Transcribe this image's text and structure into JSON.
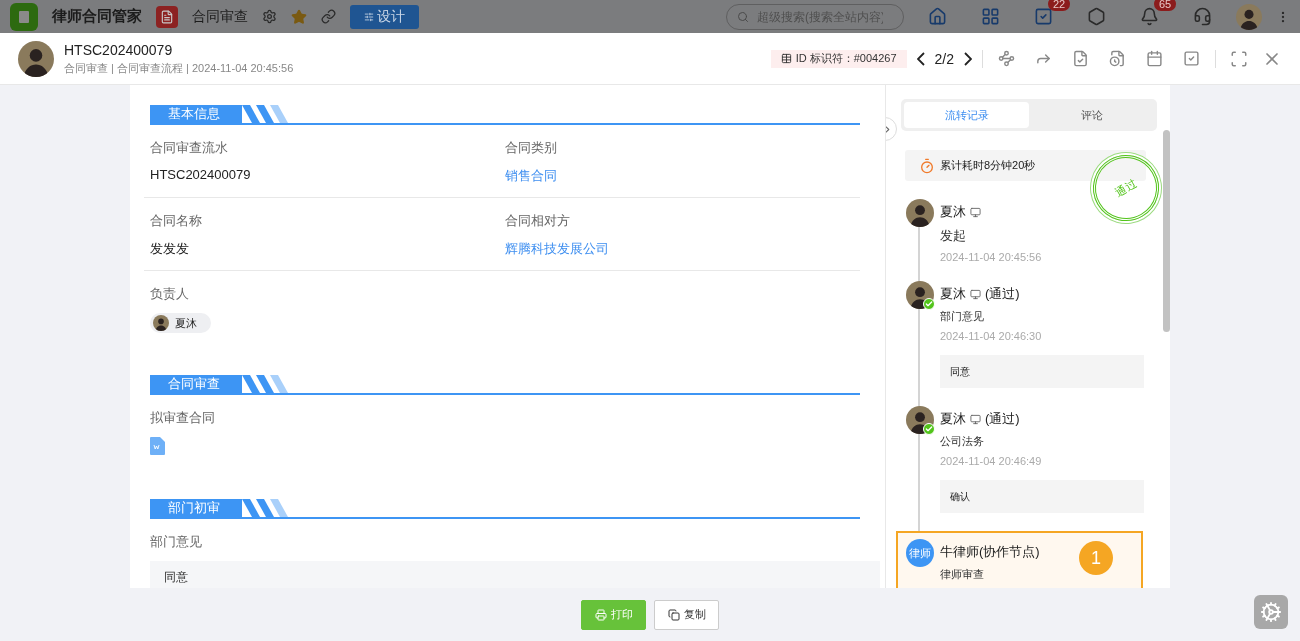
{
  "app_bar": {
    "app_name": "律师合同管家",
    "module": "合同审查",
    "design_button": "设计",
    "search": {
      "placeholder": "超级搜索(搜索全站内容)"
    },
    "badges": [
      {
        "kind": "tasks",
        "count": "22"
      },
      {
        "kind": "notifications",
        "count": "65"
      }
    ]
  },
  "record": {
    "title": "HTSC202400079",
    "subtitle": "合同审查 | 合同审查流程 | 2024-11-04 20:45:56",
    "id_label": "ID 标识符：#004267",
    "pager": "2/2"
  },
  "sections": [
    {
      "title": "基本信息",
      "rows": [
        [
          {
            "kind": "text",
            "label": "合同审查流水",
            "value": "HTSC202400079"
          },
          {
            "kind": "link",
            "label": "合同类别",
            "value": "销售合同"
          }
        ],
        [
          {
            "kind": "text",
            "label": "合同名称",
            "value": "发发发"
          },
          {
            "kind": "link",
            "label": "合同相对方",
            "value": "辉腾科技发展公司"
          }
        ],
        [
          {
            "kind": "person",
            "label": "负责人",
            "value": "夏沐"
          }
        ]
      ]
    },
    {
      "title": "合同审查",
      "rows": [
        [
          {
            "kind": "file",
            "label": "拟审查合同"
          }
        ]
      ]
    },
    {
      "title": "部门初审",
      "rows": [
        [
          {
            "kind": "opinion",
            "label": "部门意见",
            "value": "同意"
          }
        ]
      ]
    }
  ],
  "panel": {
    "tabs": [
      {
        "label": "流转记录",
        "selected": true
      },
      {
        "label": "评论",
        "selected": false
      }
    ],
    "elapsed": "累计耗时8分钟20秒",
    "stamp": "通过",
    "entries": [
      {
        "kind": "start",
        "name": "夏沐",
        "step": "发起",
        "time": "2024-11-04 20:45:56"
      },
      {
        "kind": "approved",
        "name": "夏沐",
        "result": "(通过)",
        "step": "部门意见",
        "time": "2024-11-04 20:46:30",
        "comment": "同意"
      },
      {
        "kind": "approved",
        "name": "夏沐",
        "result": "(通过)",
        "step": "公司法务",
        "time": "2024-11-04 20:46:49",
        "comment": "确认"
      },
      {
        "kind": "pending",
        "avatar_text": "律师",
        "name": "牛律师(协作节点)",
        "step": "律师审查",
        "count": "1"
      }
    ]
  },
  "buttons": [
    {
      "kind": "print",
      "label": "打印"
    },
    {
      "kind": "copy",
      "label": "复制"
    }
  ]
}
